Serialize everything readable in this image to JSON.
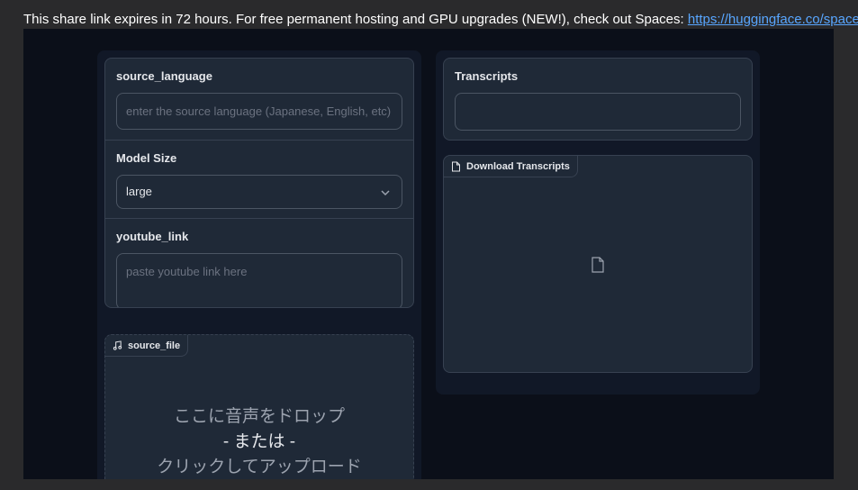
{
  "banner": {
    "text": "This share link expires in 72 hours. For free permanent hosting and GPU upgrades (NEW!), check out Spaces: ",
    "link": "https://huggingface.co/spaces"
  },
  "form": {
    "source_language": {
      "label": "source_language",
      "placeholder": "enter the source language (Japanese, English, etc)"
    },
    "model_size": {
      "label": "Model Size",
      "value": "large"
    },
    "youtube_link": {
      "label": "youtube_link",
      "placeholder": "paste youtube link here"
    }
  },
  "audio": {
    "label": "source_file",
    "icon": "music-note-icon",
    "drop_line1": "ここに音声をドロップ",
    "drop_line2": "- または -",
    "drop_line3": "クリックしてアップロード"
  },
  "transcripts": {
    "label": "Transcripts",
    "value": ""
  },
  "download": {
    "label": "Download Transcripts",
    "icon": "file-icon"
  },
  "colors": {
    "background": "#0b0f19",
    "panel": "#1f2937",
    "border": "#374151",
    "link": "#58a6ff"
  }
}
